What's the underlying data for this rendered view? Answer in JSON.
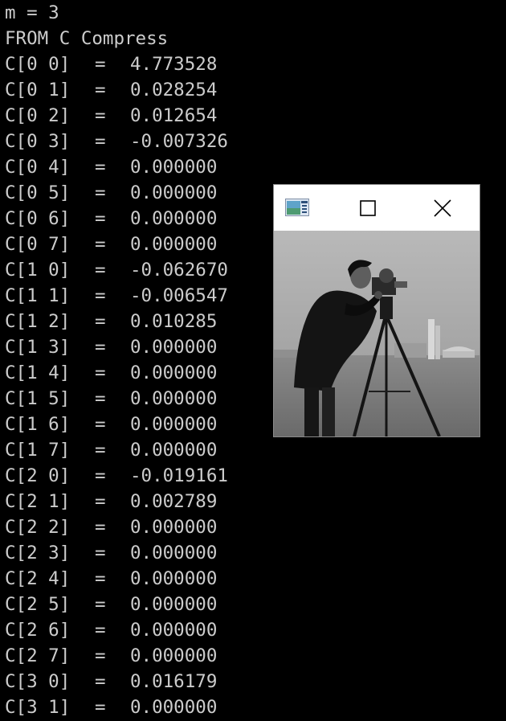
{
  "console": {
    "header": [
      "m = 3",
      "FROM C Compress"
    ],
    "rows": [
      {
        "label": "C[0 0]",
        "value": "4.773528"
      },
      {
        "label": "C[0 1]",
        "value": "0.028254"
      },
      {
        "label": "C[0 2]",
        "value": "0.012654"
      },
      {
        "label": "C[0 3]",
        "value": "-0.007326"
      },
      {
        "label": "C[0 4]",
        "value": "0.000000"
      },
      {
        "label": "C[0 5]",
        "value": "0.000000"
      },
      {
        "label": "C[0 6]",
        "value": "0.000000"
      },
      {
        "label": "C[0 7]",
        "value": "0.000000"
      },
      {
        "label": "C[1 0]",
        "value": "-0.062670"
      },
      {
        "label": "C[1 1]",
        "value": "-0.006547"
      },
      {
        "label": "C[1 2]",
        "value": "0.010285"
      },
      {
        "label": "C[1 3]",
        "value": "0.000000"
      },
      {
        "label": "C[1 4]",
        "value": "0.000000"
      },
      {
        "label": "C[1 5]",
        "value": "0.000000"
      },
      {
        "label": "C[1 6]",
        "value": "0.000000"
      },
      {
        "label": "C[1 7]",
        "value": "0.000000"
      },
      {
        "label": "C[2 0]",
        "value": "-0.019161"
      },
      {
        "label": "C[2 1]",
        "value": "0.002789"
      },
      {
        "label": "C[2 2]",
        "value": "0.000000"
      },
      {
        "label": "C[2 3]",
        "value": "0.000000"
      },
      {
        "label": "C[2 4]",
        "value": "0.000000"
      },
      {
        "label": "C[2 5]",
        "value": "0.000000"
      },
      {
        "label": "C[2 6]",
        "value": "0.000000"
      },
      {
        "label": "C[2 7]",
        "value": "0.000000"
      },
      {
        "label": "C[3 0]",
        "value": "0.016179"
      },
      {
        "label": "C[3 1]",
        "value": "0.000000"
      }
    ],
    "equals": "=",
    "colors": {
      "background": "#000000",
      "text": "#cccccc"
    }
  },
  "popup": {
    "icons": {
      "app": "app-window-icon",
      "maximize": "maximize-icon",
      "close": "close-icon"
    },
    "image": "grayscale-cameraman-photo"
  }
}
